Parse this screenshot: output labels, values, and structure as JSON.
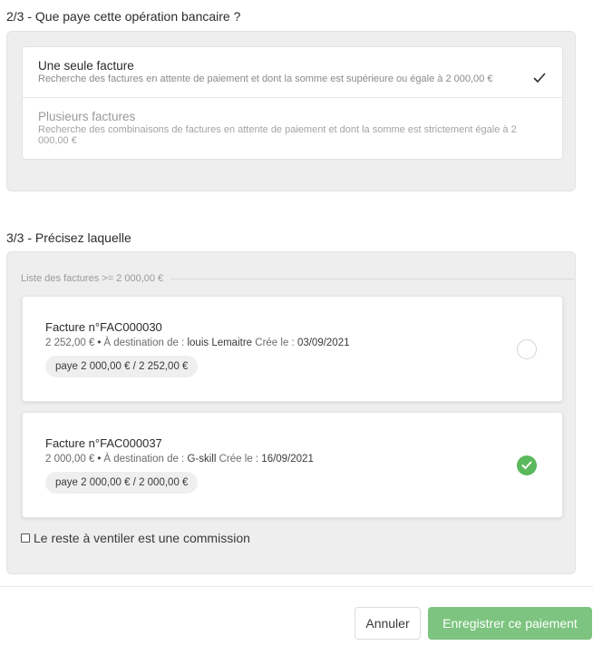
{
  "step2": {
    "title": "2/3 - Que paye cette opération bancaire ?",
    "options": [
      {
        "title": "Une seule facture",
        "description": "Recherche des factures en attente de paiement et dont la somme est supérieure ou égale à 2 000,00 €",
        "selected": true
      },
      {
        "title": "Plusieurs factures",
        "description": "Recherche des combinaisons de factures en attente de paiement et dont la somme est strictement égale à 2 000,00 €",
        "selected": false
      }
    ]
  },
  "step3": {
    "title": "3/3 - Précisez laquelle",
    "list_label": "Liste des factures >= 2 000,00 €",
    "invoices": [
      {
        "title": "Facture n°FAC000030",
        "amount": "2 252,00 €",
        "bullet": "•",
        "dest_label": "À destination de :",
        "dest_value": "louis Lemaitre",
        "date_label": "Crée le :",
        "date_value": "03/09/2021",
        "badge": "paye 2 000,00 € / 2 252,00 €",
        "selected": false
      },
      {
        "title": "Facture n°FAC000037",
        "amount": "2 000,00 €",
        "bullet": "•",
        "dest_label": "À destination de :",
        "dest_value": "G-skill",
        "date_label": "Crée le :",
        "date_value": "16/09/2021",
        "badge": "paye 2 000,00 € / 2 000,00 €",
        "selected": true
      }
    ],
    "commission_label": "Le reste à ventiler est une commission",
    "commission_checked": false
  },
  "footer": {
    "cancel_label": "Annuler",
    "save_label": "Enregistrer ce paiement"
  },
  "colors": {
    "accent_green": "#5cb85c",
    "save_button": "#7cc47f",
    "panel_bg": "#eeeeee"
  },
  "icons": {
    "selected_option": "checkmark-icon",
    "selected_invoice": "check-circle-icon",
    "unselected_invoice": "radio-empty-icon"
  }
}
